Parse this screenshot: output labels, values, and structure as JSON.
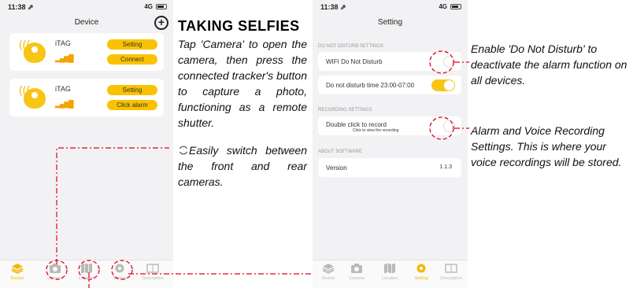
{
  "left_phone": {
    "status_time": "11:38 ⇗",
    "status_network": "4G",
    "title": "Device",
    "add_icon": "plus-circle-icon",
    "devices": [
      {
        "name": "iTAG",
        "button1": "Setting",
        "button2": "Connect"
      },
      {
        "name": "iTAG",
        "button1": "Setting",
        "button2": "Click alarm"
      }
    ],
    "tabs": [
      "Device",
      "Camera",
      "Location",
      "Setting",
      "Description"
    ]
  },
  "right_phone": {
    "status_time": "11:38 ⇗",
    "status_network": "4G",
    "title": "Setting",
    "sections": {
      "dnd": "DO NOT DISTURB SETTINGS",
      "recording": "RECORDING SETTINGS",
      "about": "ABOUT SOFTWARE"
    },
    "rows": {
      "wifi_dnd": "WIFI Do Not Disturb",
      "dnd_time": "Do not disturb time 23:00-07:00",
      "double_click": "Double click to record",
      "view_recording": "Click to view the recording",
      "version_label": "Version",
      "version_value": "1.1.3"
    },
    "tabs": [
      "Device",
      "Camera",
      "Location",
      "Setting",
      "Description"
    ]
  },
  "instructions": {
    "heading": "TAKING SELFIES",
    "selfie_text": "Tap 'Camera' to open the camera, then press the connected tracker's button to capture a photo, functioning as a remote shutter.",
    "switch_text": "Easily switch between the front and rear cameras.",
    "dnd_text": "Enable 'Do Not Disturb' to deactivate the alarm function on all devices.",
    "record_text": "Alarm and Voice Recording Settings. This is where your voice recordings will be stored."
  },
  "colors": {
    "accent": "#f7c615",
    "annotation": "#e3001b"
  }
}
